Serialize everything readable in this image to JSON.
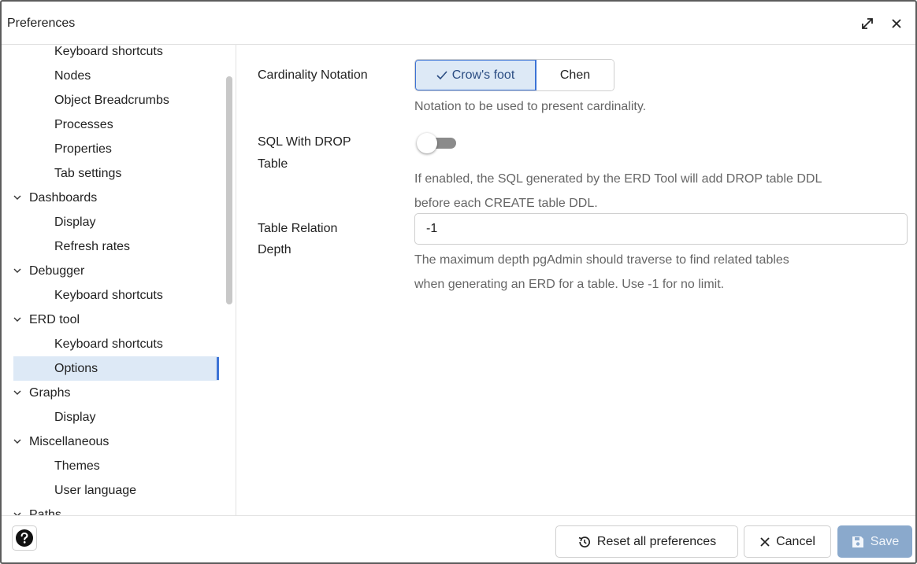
{
  "window": {
    "title": "Preferences"
  },
  "sidebar": {
    "items": [
      {
        "label": "Keyboard shortcuts",
        "level": "child"
      },
      {
        "label": "Nodes",
        "level": "child"
      },
      {
        "label": "Object Breadcrumbs",
        "level": "child"
      },
      {
        "label": "Processes",
        "level": "child"
      },
      {
        "label": "Properties",
        "level": "child"
      },
      {
        "label": "Tab settings",
        "level": "child"
      },
      {
        "label": "Dashboards",
        "level": "parent",
        "expanded": true
      },
      {
        "label": "Display",
        "level": "child"
      },
      {
        "label": "Refresh rates",
        "level": "child"
      },
      {
        "label": "Debugger",
        "level": "parent",
        "expanded": true
      },
      {
        "label": "Keyboard shortcuts",
        "level": "child"
      },
      {
        "label": "ERD tool",
        "level": "parent",
        "expanded": true
      },
      {
        "label": "Keyboard shortcuts",
        "level": "child"
      },
      {
        "label": "Options",
        "level": "child",
        "selected": true
      },
      {
        "label": "Graphs",
        "level": "parent",
        "expanded": true
      },
      {
        "label": "Display",
        "level": "child"
      },
      {
        "label": "Miscellaneous",
        "level": "parent",
        "expanded": true
      },
      {
        "label": "Themes",
        "level": "child"
      },
      {
        "label": "User language",
        "level": "child"
      },
      {
        "label": "Paths",
        "level": "parent",
        "expanded": true
      }
    ]
  },
  "settings": {
    "cardinality": {
      "label": "Cardinality Notation",
      "options": [
        "Crow's foot",
        "Chen"
      ],
      "selected": "Crow's foot",
      "help": "Notation to be used to present cardinality."
    },
    "sql_drop": {
      "label_line1": "SQL With DROP",
      "label_line2": "Table",
      "enabled": false,
      "help_line1": "If enabled, the SQL generated by the ERD Tool will add DROP table DDL",
      "help_line2": "before each CREATE table DDL."
    },
    "relation_depth": {
      "label_line1": "Table Relation",
      "label_line2": "Depth",
      "value": "-1",
      "help_line1": "The maximum depth pgAdmin should traverse to find related tables",
      "help_line2": "when generating an ERD for a table. Use -1 for no limit."
    }
  },
  "footer": {
    "help_icon": "question-circle-icon",
    "reset_label": "Reset all preferences",
    "cancel_label": "Cancel",
    "save_label": "Save"
  },
  "colors": {
    "accent": "#3c73d6",
    "selected_bg": "#dde9f6",
    "save_disabled": "#8aa9cc"
  }
}
